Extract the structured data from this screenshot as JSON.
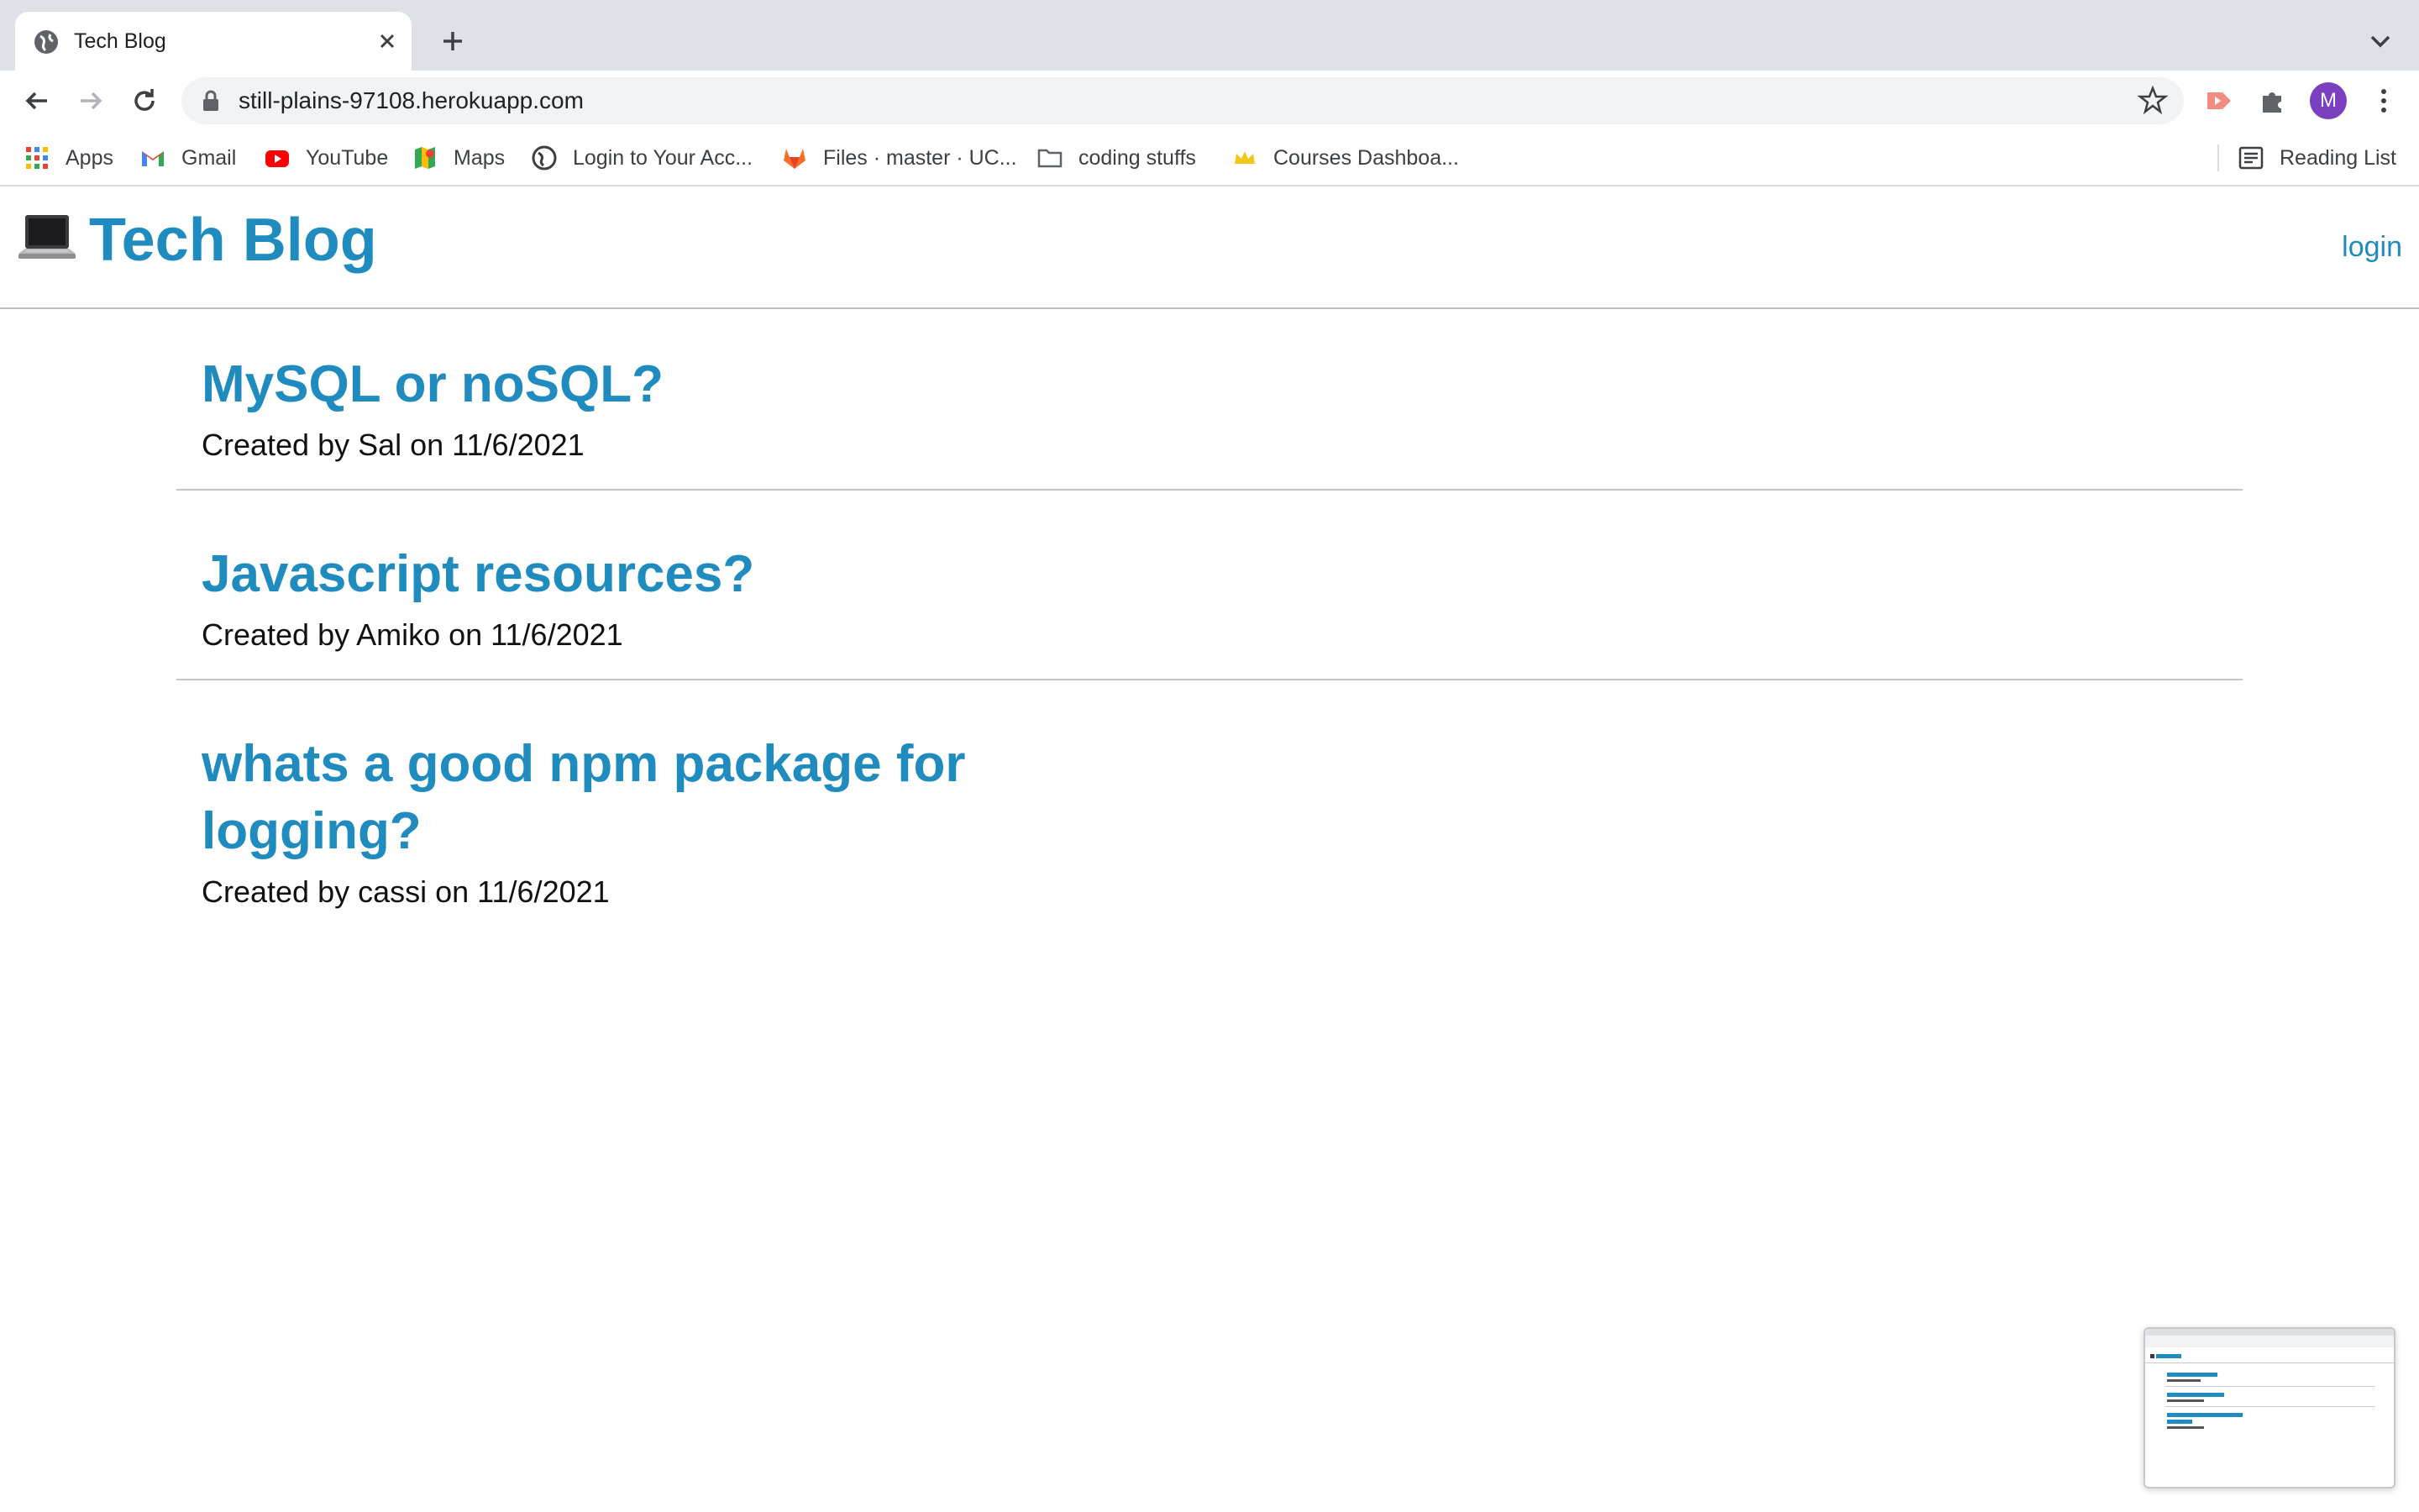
{
  "browser": {
    "tab": {
      "title": "Tech Blog"
    },
    "url": "still-plains-97108.herokuapp.com",
    "avatar_initial": "M",
    "bookmarks": [
      {
        "label": "Apps",
        "icon": "apps-grid-icon"
      },
      {
        "label": "Gmail",
        "icon": "gmail-icon"
      },
      {
        "label": "YouTube",
        "icon": "youtube-icon"
      },
      {
        "label": "Maps",
        "icon": "maps-icon"
      },
      {
        "label": "Login to Your Acc...",
        "icon": "globe-icon"
      },
      {
        "label": "Files · master · UC...",
        "icon": "gitlab-icon"
      },
      {
        "label": "coding stuffs",
        "icon": "folder-icon"
      },
      {
        "label": "Courses Dashboa...",
        "icon": "crown-icon"
      }
    ],
    "reading_list": "Reading List"
  },
  "site": {
    "logo_icon": "laptop-icon",
    "title": "Tech Blog",
    "login_label": "login",
    "accent": "#1f8bbf"
  },
  "posts": [
    {
      "title": "MySQL or noSQL?",
      "meta": "Created by Sal on 11/6/2021"
    },
    {
      "title": "Javascript resources?",
      "meta": "Created by Amiko on 11/6/2021"
    },
    {
      "title": "whats a good npm package for logging?",
      "meta": "Created by cassi on 11/6/2021"
    }
  ]
}
